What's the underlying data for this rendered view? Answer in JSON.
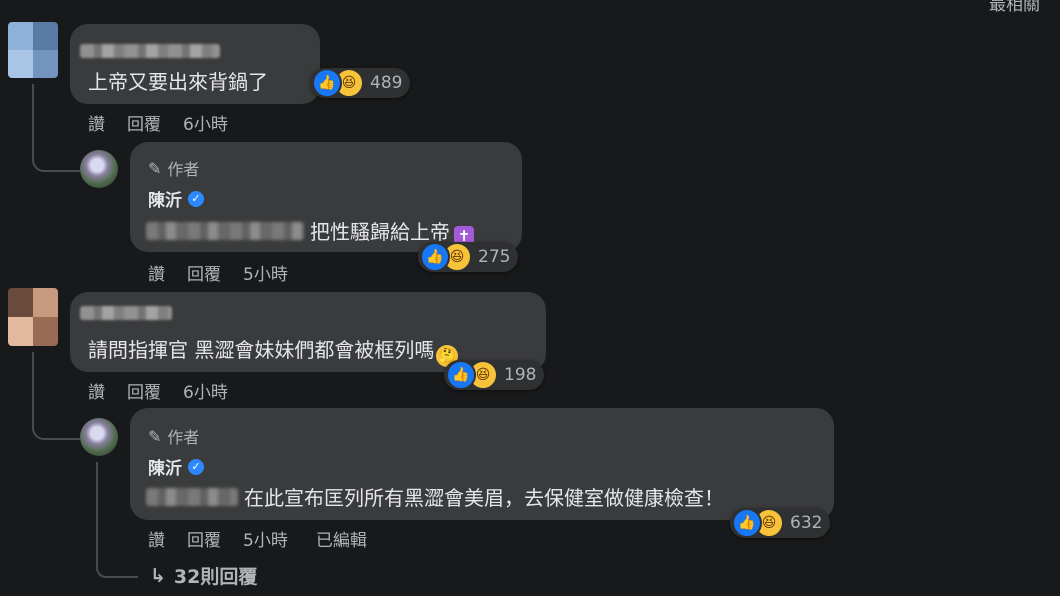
{
  "top_partial_text": "最相關",
  "comments": [
    {
      "text": "上帝又要出來背鍋了",
      "reaction_count": "489",
      "actions": {
        "like": "讚",
        "reply": "回覆",
        "time": "6小時"
      }
    },
    {
      "author_label": "作者",
      "name": "陳沂",
      "text": "把性騷歸給上帝",
      "emoji": "✝",
      "reaction_count": "275",
      "actions": {
        "like": "讚",
        "reply": "回覆",
        "time": "5小時"
      }
    },
    {
      "text": "請問指揮官 黑澀會妹妹們都會被框列嗎",
      "emoji": "🤔",
      "reaction_count": "198",
      "actions": {
        "like": "讚",
        "reply": "回覆",
        "time": "6小時"
      }
    },
    {
      "author_label": "作者",
      "name": "陳沂",
      "text": "在此宣布匡列所有黑澀會美眉，去保健室做健康檢查！",
      "reaction_count": "632",
      "actions": {
        "like": "讚",
        "reply": "回覆",
        "time": "5小時",
        "edited": "已編輯"
      }
    }
  ],
  "more_replies": "32則回覆",
  "icons": {
    "like": "like-icon",
    "haha": "haha-icon",
    "pencil": "pencil-icon",
    "verified": "verified-badge-icon",
    "reply_arrow": "reply-arrow-icon"
  },
  "colors": {
    "background": "#18191a",
    "bubble": "#3a3b3c",
    "like_blue": "#1877f2",
    "haha_yellow": "#f7c33b",
    "secondary_text": "#b0b3b8"
  }
}
